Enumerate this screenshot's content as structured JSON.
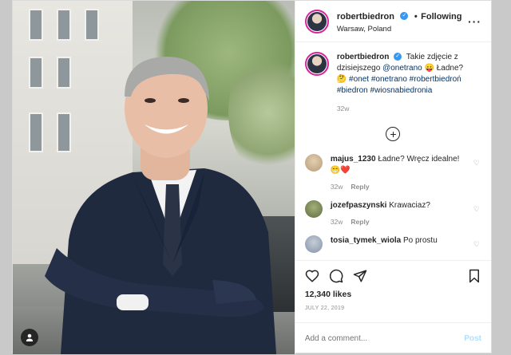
{
  "post": {
    "username": "robertbiedron",
    "follow_label": "Following",
    "separator": "•",
    "location": "Warsaw, Poland",
    "more_icon": "more-horizontal-icon",
    "caption": {
      "username": "robertbiedron",
      "text": "Takie zdjęcie z dzisiejszego",
      "mention": "@onetrano",
      "text2": "😛 Ładne?🤔",
      "hashtags": "#onet #onetrano #robertbiedroń #biedron #wiosnabiedronia",
      "time": "32w"
    },
    "load_more_icon": "plus-circle-icon",
    "comments": [
      {
        "username": "majus_1230",
        "text": "Ładne? Wręcz idealne! 😁❤️",
        "time": "32w",
        "reply": "Reply",
        "avatar_color": "#c9b9a3"
      },
      {
        "username": "jozefpaszynski",
        "text": "Krawaciaz?",
        "time": "32w",
        "reply": "Reply",
        "avatar_color": "#7a8a5a"
      },
      {
        "username": "tosia_tymek_wiola",
        "text": "Po prostu",
        "time": "",
        "reply": "",
        "avatar_color": "#9aa7b8"
      }
    ],
    "likes": "12,340 likes",
    "date": "JULY 22, 2019",
    "add_comment_placeholder": "Add a comment...",
    "post_label": "Post"
  },
  "colors": {
    "link": "#003569",
    "verified": "#3897f0",
    "muted": "#8e8e8e",
    "post_button": "#b2dffc"
  }
}
